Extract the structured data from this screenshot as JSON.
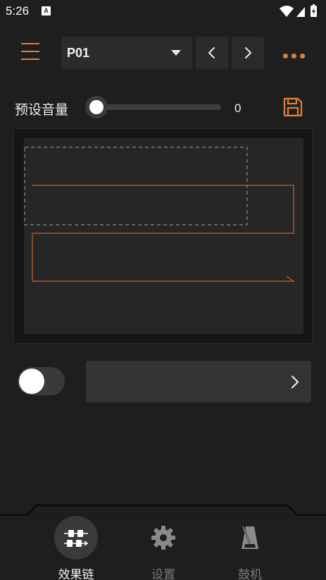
{
  "status_bar": {
    "time": "5:26",
    "app_icon_letter": "A",
    "icons": [
      "wifi-icon",
      "signal-icon",
      "battery-charging-icon"
    ]
  },
  "toolbar": {
    "menu_icon": "hamburger-menu-icon",
    "preset_name": "P01",
    "dropdown_icon": "caret-down-icon",
    "prev_icon": "chevron-left-icon",
    "next_icon": "chevron-right-icon",
    "more_icon": "more-horizontal-icon"
  },
  "volume": {
    "label": "预设音量",
    "value": "0",
    "level": 0,
    "save_icon": "save-icon"
  },
  "chain": {
    "empty": true
  },
  "controls": {
    "toggle_on": false,
    "detail_icon": "chevron-right-icon"
  },
  "bottom_nav": {
    "items": [
      {
        "label": "效果链",
        "icon": "effects-chain-icon",
        "active": true
      },
      {
        "label": "设置",
        "icon": "gear-icon",
        "active": false
      },
      {
        "label": "鼓机",
        "icon": "metronome-icon",
        "active": false
      }
    ]
  },
  "colors": {
    "accent": "#e0803a",
    "background": "#1e1e1e",
    "panel": "#2b2b2b"
  }
}
